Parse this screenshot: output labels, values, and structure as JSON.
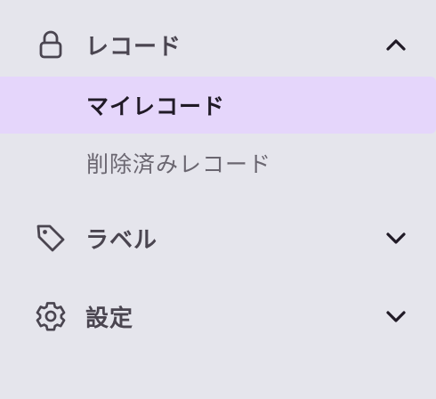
{
  "nav": {
    "records": {
      "label": "レコード",
      "icon": "lock-icon",
      "expanded": true,
      "items": [
        {
          "label": "マイレコード",
          "active": true
        },
        {
          "label": "削除済みレコード",
          "active": false
        }
      ]
    },
    "labels": {
      "label": "ラベル",
      "icon": "tag-icon",
      "expanded": false
    },
    "settings": {
      "label": "設定",
      "icon": "gear-icon",
      "expanded": false
    }
  },
  "colors": {
    "background": "#e5e5ec",
    "active_background": "#e5d6fb",
    "text": "#4a4550",
    "active_text": "#201a26",
    "muted_text": "#6a6670"
  }
}
